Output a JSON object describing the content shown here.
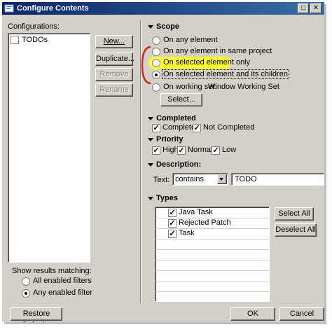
{
  "window": {
    "title": "Configure Contents"
  },
  "left": {
    "configurations_label": "Configurations:",
    "items": [
      {
        "label": "TODOs",
        "checked": false
      }
    ],
    "buttons": {
      "new": "New...",
      "duplicate": "Duplicate...",
      "remove": "Remove",
      "rename": "Rename"
    },
    "show_results_label": "Show results matching:",
    "matching_options": [
      {
        "label": "All enabled filters",
        "selected": false
      },
      {
        "label": "Any enabled filter",
        "selected": true
      }
    ],
    "restore_defaults": "Restore Defaults"
  },
  "scope": {
    "title": "Scope",
    "options": [
      {
        "label": "On any element",
        "selected": false
      },
      {
        "label": "On any element in same project",
        "selected": false
      },
      {
        "label": "On selected element only",
        "selected": false
      },
      {
        "label": "On selected element and its children",
        "selected": true
      },
      {
        "label": "On working set:",
        "selected": false
      }
    ],
    "working_set_value": "Window Working Set",
    "select_button": "Select..."
  },
  "completed": {
    "title": "Completed",
    "options": [
      {
        "label": "Completed",
        "checked": true
      },
      {
        "label": "Not Completed",
        "checked": true
      }
    ]
  },
  "priority": {
    "title": "Priority",
    "options": [
      {
        "label": "High",
        "checked": true
      },
      {
        "label": "Normal",
        "checked": true
      },
      {
        "label": "Low",
        "checked": true
      }
    ]
  },
  "description": {
    "title": "Description:",
    "text_label": "Text:",
    "operator": "contains",
    "value": "TODO"
  },
  "types": {
    "title": "Types",
    "items": [
      {
        "label": "Java Task",
        "checked": true
      },
      {
        "label": "Rejected Patch",
        "checked": true
      },
      {
        "label": "Task",
        "checked": true
      }
    ],
    "select_all": "Select All",
    "deselect_all": "Deselect All"
  },
  "footer": {
    "ok": "OK",
    "cancel": "Cancel"
  },
  "colors": {
    "highlight": "#ffff33",
    "annotation": "#cc2222",
    "title_start": "#0a246a",
    "title_end": "#3a6ea5"
  }
}
